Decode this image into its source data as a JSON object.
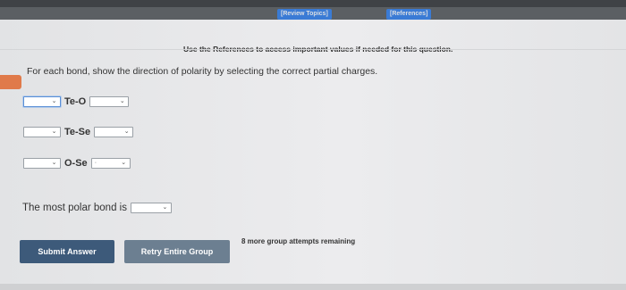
{
  "topbar": {
    "review_link": "[Review Topics]",
    "references_link": "[References]"
  },
  "notice": "Use the References to access important values if needed for this question.",
  "question": {
    "instructions": "For each bond, show the direction of polarity by selecting the correct partial charges.",
    "bonds": [
      {
        "label": "Te-O",
        "left_value": "",
        "right_value": ""
      },
      {
        "label": "Te-Se",
        "left_value": "",
        "right_value": ""
      },
      {
        "label": "O-Se",
        "left_value": "",
        "right_value": "·"
      }
    ],
    "polar_prompt": "The most polar bond is",
    "polar_value": ""
  },
  "icons": {
    "dropdown": "chevron-down-icon"
  },
  "colors": {
    "submit": "#3d5a7a",
    "retry": "#6c7f91",
    "accent": "#e07a4a"
  },
  "actions": {
    "submit_label": "Submit Answer",
    "retry_label": "Retry Entire Group",
    "attempts_text": "8 more group attempts remaining"
  }
}
